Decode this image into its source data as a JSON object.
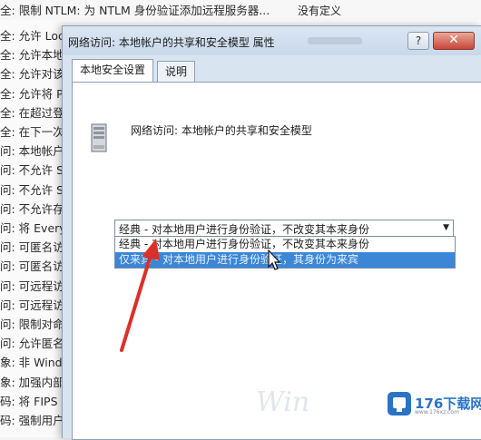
{
  "background": {
    "top_row": {
      "prefix": "全:",
      "text": "限制 NTLM: 为 NTLM 身份验证添加远程服务器...",
      "note": "没有定义"
    },
    "rows": [
      "全: 允许 Loc",
      "全: 允许本地",
      "全: 允许对该",
      "全: 允许将 P",
      "全: 在超过登",
      "全: 在下一次",
      "问: 本地帐户",
      "问: 不允许 S",
      "问: 不允许 S",
      "问: 不允许存",
      "问: 将 Every",
      "问: 可匿名访",
      "问: 可匿名访",
      "问: 可远程访",
      "问: 可远程访",
      "问: 限制对命",
      "问: 允许匿名",
      "象: 非 Wind",
      "象: 加强内部",
      "码: 将 FIPS",
      "码: 强制用户"
    ]
  },
  "dialog": {
    "title": "网络访问: 本地帐户的共享和安全模型 属性",
    "help_label": "?",
    "close_label": "✕",
    "tabs": [
      {
        "label": "本地安全设置",
        "active": true
      },
      {
        "label": "说明",
        "active": false
      }
    ],
    "policy_name": "网络访问: 本地帐户的共享和安全模型",
    "select": {
      "value": "经典 - 对本地用户进行身份验证，不改变其本来身份",
      "options": [
        {
          "label": "经典 - 对本地用户进行身份验证，不改变其本来身份",
          "selected": false
        },
        {
          "label": "仅来宾 - 对本地用户进行身份验证，其身份为来宾",
          "selected": true
        }
      ]
    }
  },
  "watermark": {
    "text": "Win"
  },
  "brand": {
    "text": "176下载网",
    "sub": "www.176xz.com",
    "color": "#2a74c6"
  },
  "colors": {
    "selection": "#3b86d6",
    "annotation_arrow": "#d9312a",
    "titlebar": "#c9d8ea"
  }
}
